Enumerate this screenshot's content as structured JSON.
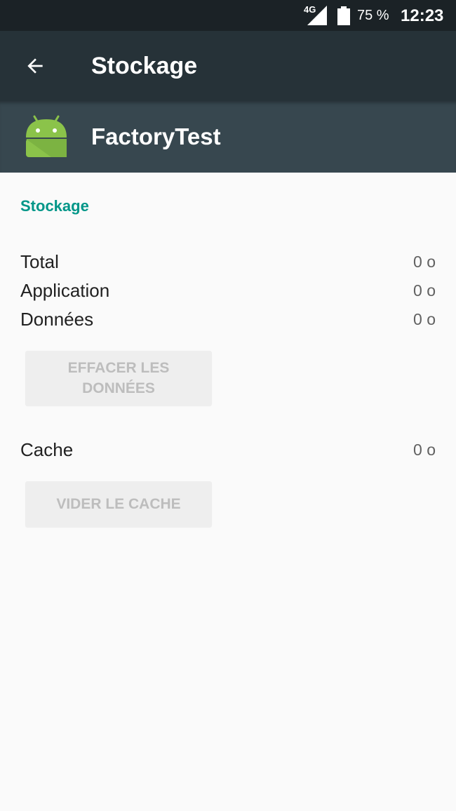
{
  "status_bar": {
    "network": "4G",
    "battery_percent": "75 %",
    "time": "12:23",
    "battery_level": 0.75
  },
  "app_bar": {
    "back_icon": "arrow-back-icon",
    "title": "Stockage"
  },
  "app_header": {
    "icon": "android-icon",
    "icon_color": "#8bc34a",
    "app_name": "FactoryTest"
  },
  "storage": {
    "section_title": "Stockage",
    "accent_color": "#009688",
    "rows": [
      {
        "label": "Total",
        "value": "0 o"
      },
      {
        "label": "Application",
        "value": "0 o"
      },
      {
        "label": "Données",
        "value": "0 o"
      }
    ],
    "clear_data_button": {
      "line1": "EFFACER LES",
      "line2": "DONNÉES",
      "enabled": false
    }
  },
  "cache": {
    "label": "Cache",
    "value": "0 o",
    "clear_cache_button": {
      "label": "VIDER LE CACHE",
      "enabled": false
    }
  }
}
